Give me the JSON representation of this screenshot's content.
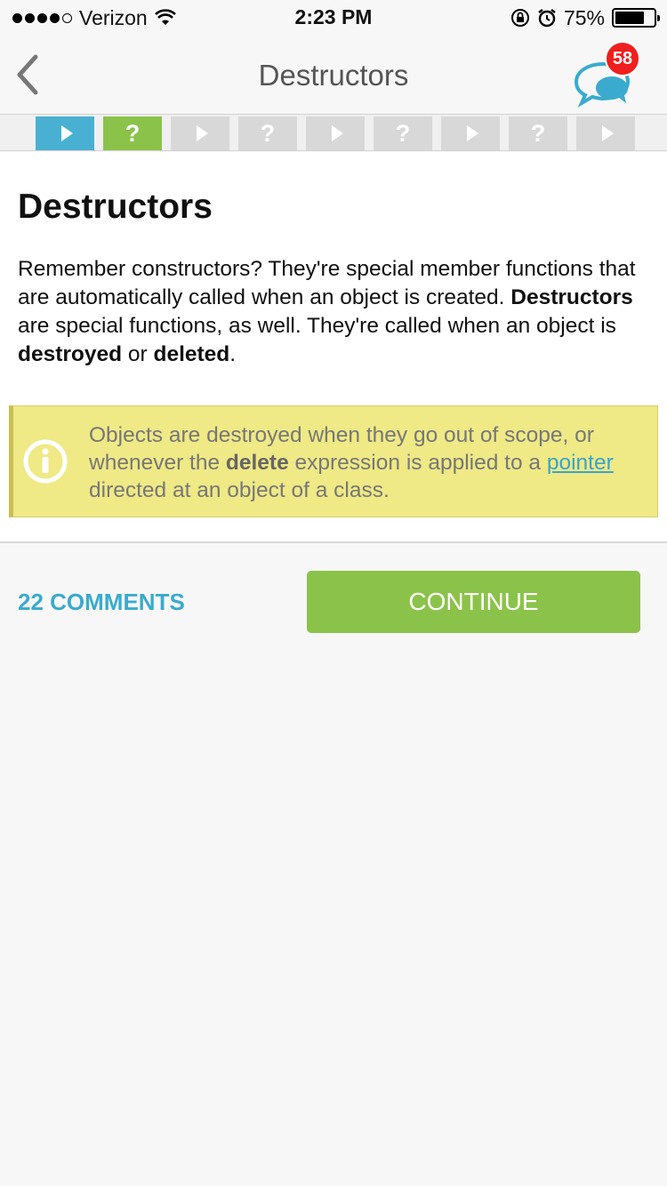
{
  "status_bar": {
    "carrier": "Verizon",
    "time": "2:23 PM",
    "battery": "75%",
    "battery_level": 0.75
  },
  "nav": {
    "title": "Destructors",
    "notification_count": "58",
    "back_icon": "chevron-left-icon",
    "chat_icon": "chat-bubbles-icon"
  },
  "progress_steps": [
    {
      "kind": "lesson",
      "state": "current"
    },
    {
      "kind": "quiz",
      "state": "completed",
      "glyph": "?"
    },
    {
      "kind": "lesson",
      "state": "locked"
    },
    {
      "kind": "quiz",
      "state": "locked",
      "glyph": "?"
    },
    {
      "kind": "lesson",
      "state": "locked"
    },
    {
      "kind": "quiz",
      "state": "locked",
      "glyph": "?"
    },
    {
      "kind": "lesson",
      "state": "locked"
    },
    {
      "kind": "quiz",
      "state": "locked",
      "glyph": "?"
    },
    {
      "kind": "lesson",
      "state": "locked"
    }
  ],
  "lesson": {
    "title": "Destructors",
    "p1": "Remember constructors? They're special member functions that are automatically called when an object is created. ",
    "b1": "Destructors",
    "p2": " are special functions, as well. They're called when an object is ",
    "b2": "destroyed",
    "p3": " or ",
    "b3": "deleted",
    "p4": "."
  },
  "note": {
    "icon": "info-icon",
    "t1": "Objects are destroyed when they go out of scope, or whenever the ",
    "b1": "delete",
    "t2": " expression is applied to a ",
    "link": "pointer",
    "t3": " directed at an object of a class."
  },
  "footer": {
    "comments_label": "22 COMMENTS",
    "continue_label": "CONTINUE"
  },
  "colors": {
    "accent_blue": "#4ab0d2",
    "accent_green": "#8bc34a",
    "note_bg": "#efe986",
    "badge_red": "#f01e1e"
  }
}
